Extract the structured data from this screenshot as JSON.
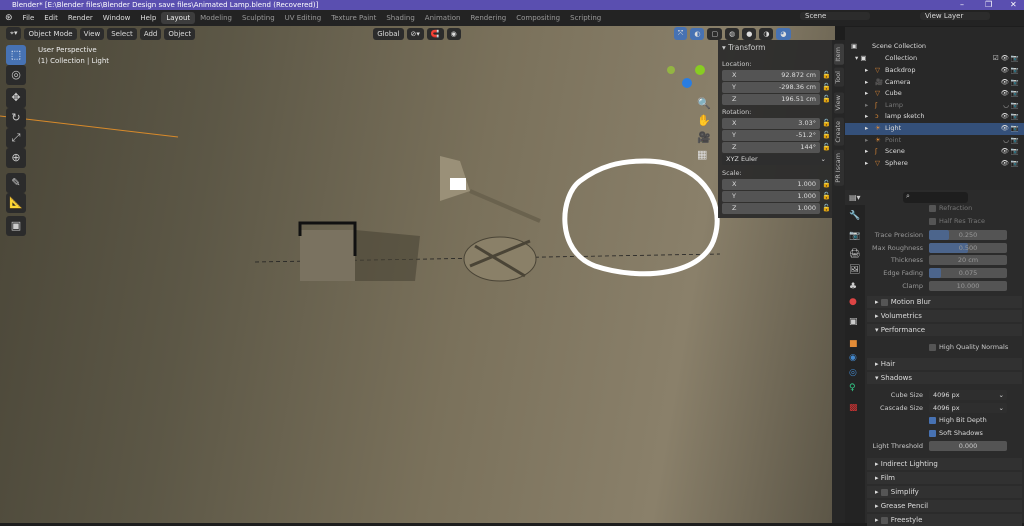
{
  "title": "Blender* [E:\\Blender files\\Blender Design save files\\Animated Lamp.blend (Recovered)]",
  "menu": [
    "File",
    "Edit",
    "Render",
    "Window",
    "Help"
  ],
  "workspaces": [
    "Layout",
    "Modeling",
    "Sculpting",
    "UV Editing",
    "Texture Paint",
    "Shading",
    "Animation",
    "Rendering",
    "Compositing",
    "Scripting"
  ],
  "scene": "Scene",
  "view_layer": "View Layer",
  "viewport": {
    "mode": "Object Mode",
    "menus": [
      "View",
      "Select",
      "Add",
      "Object"
    ],
    "orientation": "Global",
    "perspective": "User Perspective",
    "context": "(1) Collection | Light"
  },
  "sidebar": {
    "tabs": [
      "Item",
      "Tool",
      "View",
      "Create",
      "PR Iscam"
    ],
    "panel": "Transform",
    "location_label": "Location:",
    "location": [
      {
        "k": "X",
        "v": "92.872 cm"
      },
      {
        "k": "Y",
        "v": "-298.36 cm"
      },
      {
        "k": "Z",
        "v": "196.51 cm"
      }
    ],
    "rotation_label": "Rotation:",
    "rotation": [
      {
        "k": "X",
        "v": "3.03°"
      },
      {
        "k": "Y",
        "v": "-51.2°"
      },
      {
        "k": "Z",
        "v": "144°"
      }
    ],
    "rotation_mode": "XYZ Euler",
    "scale_label": "Scale:",
    "scale": [
      {
        "k": "X",
        "v": "1.000"
      },
      {
        "k": "Y",
        "v": "1.000"
      },
      {
        "k": "Z",
        "v": "1.000"
      }
    ]
  },
  "outliner": {
    "root": "Scene Collection",
    "collection": "Collection",
    "items": [
      {
        "name": "Backdrop",
        "state": "normal"
      },
      {
        "name": "Camera",
        "state": "normal"
      },
      {
        "name": "Cube",
        "state": "normal"
      },
      {
        "name": "Lamp",
        "state": "hidden"
      },
      {
        "name": "lamp sketch",
        "state": "normal"
      },
      {
        "name": "Light",
        "state": "selected"
      },
      {
        "name": "Point",
        "state": "hidden"
      },
      {
        "name": "Scene",
        "state": "normal"
      },
      {
        "name": "Sphere",
        "state": "normal"
      }
    ]
  },
  "properties": {
    "refraction": "Refraction",
    "half_res": "Half Res Trace",
    "fields": [
      {
        "label": "Trace Precision",
        "value": "0.250",
        "fill": 0.25
      },
      {
        "label": "Max Roughness",
        "value": "0.500",
        "fill": 0.5
      },
      {
        "label": "Thickness",
        "value": "20 cm",
        "fill": 0
      },
      {
        "label": "Edge Fading",
        "value": "0.075",
        "fill": 0.15
      },
      {
        "label": "Clamp",
        "value": "10.000",
        "fill": 0
      }
    ],
    "panels": {
      "motion_blur": "Motion Blur",
      "volumetrics": "Volumetrics",
      "performance": "Performance",
      "hq_normals": "High Quality Normals",
      "hair": "Hair",
      "shadows": "Shadows",
      "indirect": "Indirect Lighting",
      "film": "Film",
      "simplify": "Simplify",
      "grease": "Grease Pencil",
      "freestyle": "Freestyle"
    },
    "cube_size_label": "Cube Size",
    "cube_size": "4096 px",
    "cascade_label": "Cascade Size",
    "cascade_size": "4096 px",
    "high_bit": "High Bit Depth",
    "soft_shadows": "Soft Shadows",
    "light_threshold_label": "Light Threshold",
    "light_threshold": "0.000"
  }
}
